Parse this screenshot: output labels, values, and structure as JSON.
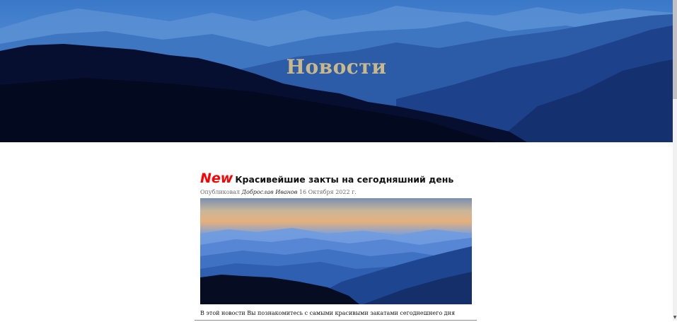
{
  "header": {
    "title": "Новости"
  },
  "article": {
    "badge": "New",
    "title": "Красивейшие закты на сегодняшний день",
    "meta": {
      "prefix": "Опубликовал",
      "author": "Доброслав Иванов",
      "date": "16 Октября 2022 г."
    },
    "summary": "В этой новости Вы познакомитесь с самыми красивыми закатами сегоднешнего дня"
  },
  "colors": {
    "title": "#c9b98a",
    "badge": "#ff0000",
    "hero_sky": "#2f6bb8",
    "hero_dark": "#050d2a"
  }
}
